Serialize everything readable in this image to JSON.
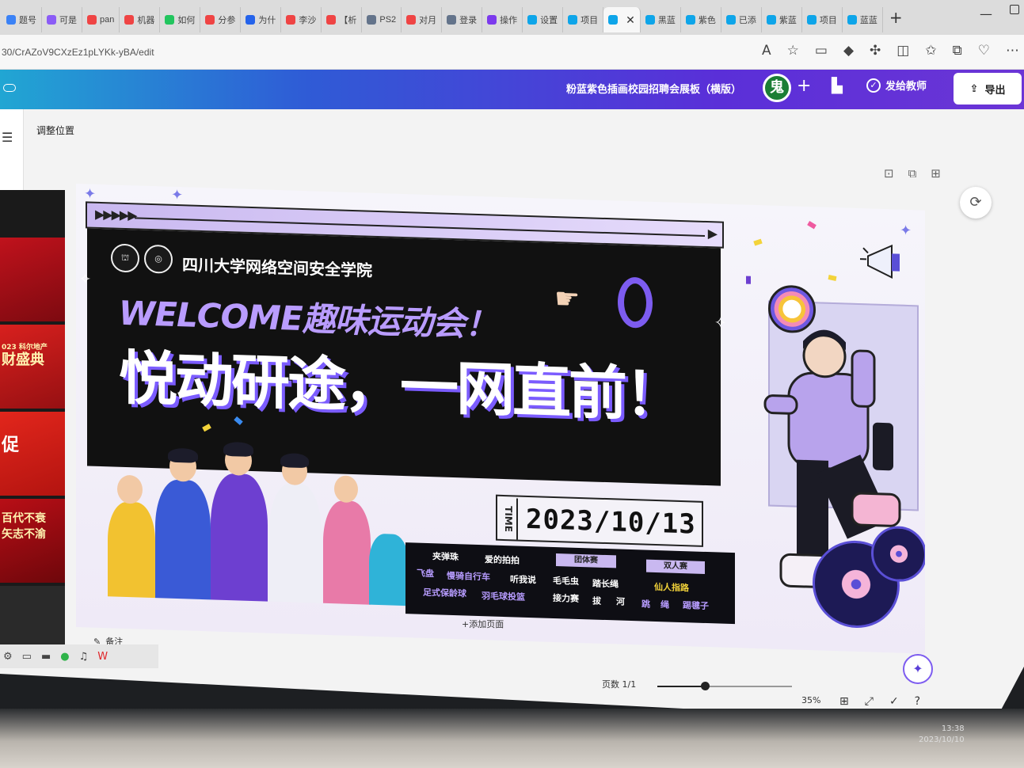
{
  "browser": {
    "tabs": [
      {
        "label": "题号",
        "color": "#3b82f6"
      },
      {
        "label": "可是",
        "color": "#8b5cf6"
      },
      {
        "label": "pan",
        "color": "#ef4444"
      },
      {
        "label": "机器",
        "color": "#ef4444"
      },
      {
        "label": "如何",
        "color": "#22c55e"
      },
      {
        "label": "分参",
        "color": "#ef4444"
      },
      {
        "label": "为什",
        "color": "#2563eb"
      },
      {
        "label": "李沙",
        "color": "#ef4444"
      },
      {
        "label": "【析",
        "color": "#ef4444"
      },
      {
        "label": "PS2",
        "color": "#64748b"
      },
      {
        "label": "对月",
        "color": "#ef4444"
      },
      {
        "label": "登录",
        "color": "#64748b"
      },
      {
        "label": "操作",
        "color": "#7c3aed"
      },
      {
        "label": "设置",
        "color": "#0ea5e9"
      },
      {
        "label": "项目",
        "color": "#0ea5e9"
      },
      {
        "label": "黑蓝",
        "color": "#0ea5e9"
      },
      {
        "label": "紫色",
        "color": "#0ea5e9"
      },
      {
        "label": "已添",
        "color": "#0ea5e9"
      },
      {
        "label": "紫蓝",
        "color": "#0ea5e9"
      },
      {
        "label": "项目",
        "color": "#0ea5e9"
      },
      {
        "label": "蓝蓝",
        "color": "#0ea5e9"
      }
    ],
    "url": "30/CrAZoV9CXzEz1pLYKk-yBA/edit"
  },
  "header": {
    "doc_title": "粉蓝紫色插画校园招聘会展板（横版）",
    "avatar_char": "鬼",
    "share_label": "发给教师",
    "export_label": "导出"
  },
  "toolbar": {
    "adjust_label": "调整位置"
  },
  "thumbs": {
    "t3": "023 科尔地产",
    "t4": "财盛典",
    "t5": "促",
    "t6a": "百代不衰",
    "t6b": "矢志不渝"
  },
  "poster": {
    "school_name": "四川大学网络空间安全学院",
    "welcome": "WELCOME趣味运动会！",
    "slogan": "悦动研途，一网直前！",
    "time_label": "TIME",
    "date": "2023/10/13",
    "events": {
      "col1": [
        "夹弹珠",
        "爱的拍拍",
        "飞盘",
        "慢骑自行车",
        "听我说",
        "足式保龄球",
        "羽毛球投篮"
      ],
      "team_badge": "团体赛",
      "team": [
        "毛毛虫",
        "踏长绳",
        "接力赛",
        "拔",
        "河"
      ],
      "pair_badge": "双人赛",
      "pair": [
        "仙人指路",
        "跳",
        "绳",
        "踢毽子"
      ]
    }
  },
  "footer": {
    "add_page": "+添加页面",
    "notes": "备注",
    "page_count": "页数 1/1",
    "zoom": "35%",
    "zoom_level": 0.35,
    "time": "13:38",
    "date": "2023/10/10"
  }
}
